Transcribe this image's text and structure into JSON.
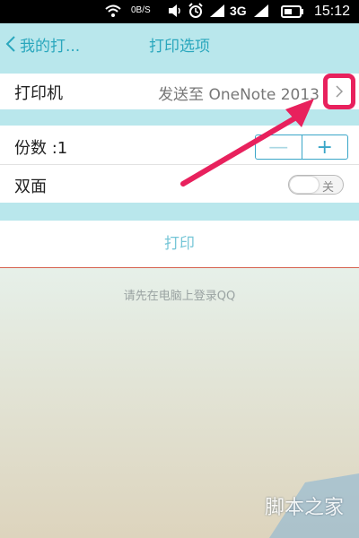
{
  "status_bar": {
    "speed": "0B/S",
    "network": "3G",
    "time": "15:12",
    "icons": [
      "wifi-icon",
      "volume-icon",
      "alarm-icon",
      "signal-icon",
      "signal-icon",
      "battery-icon"
    ]
  },
  "header": {
    "back_label": "我的打...",
    "title": "打印选项"
  },
  "options": {
    "printer": {
      "label": "打印机",
      "value": "发送至 OneNote 2013"
    },
    "copies": {
      "label": "份数 :1",
      "minus": "—",
      "plus": "+"
    },
    "duplex": {
      "label": "双面",
      "toggle_text": "关",
      "enabled": false
    }
  },
  "print_button": "打印",
  "message": "请先在电脑上登录QQ",
  "watermark": "脚本之家",
  "colors": {
    "accent": "#2aa7bd",
    "highlight": "#e8215d",
    "arrow": "#e8215d"
  }
}
